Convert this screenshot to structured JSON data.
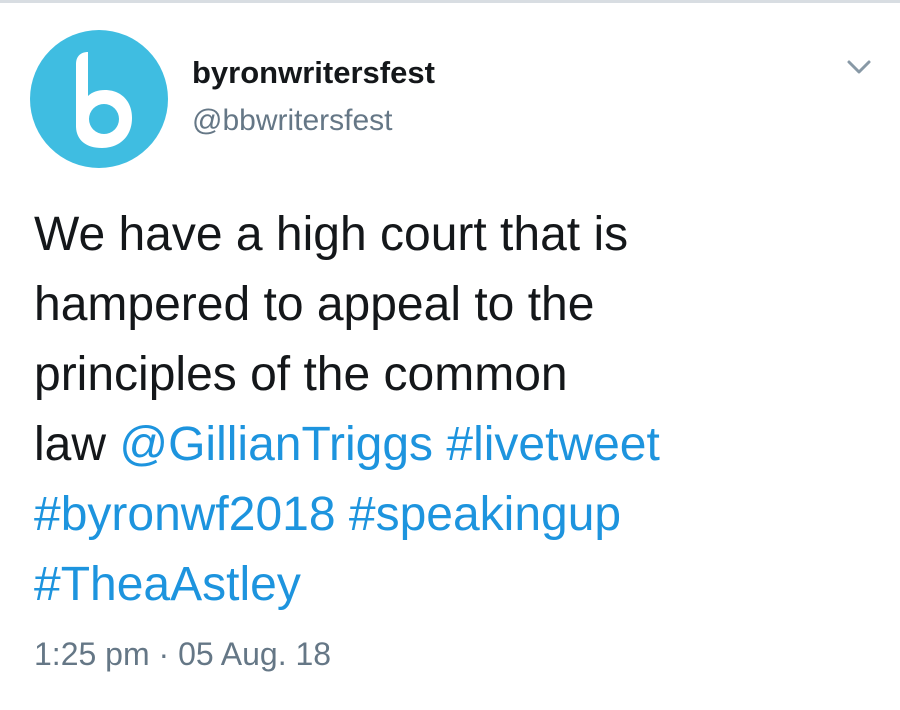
{
  "author": {
    "display_name": "byronwritersfest",
    "handle": "@bbwritersfest",
    "avatar_letter": "b",
    "avatar_color": "#3fbde1"
  },
  "tweet": {
    "text_line_1": "We have a high court that is",
    "text_line_2": "hampered to appeal to the",
    "text_line_3": "principles of the common",
    "text_line_4_prefix": "law ",
    "mention": "@GillianTriggs",
    "hashtag_1": "#livetweet",
    "hashtag_2": "#byronwf2018",
    "hashtag_3": "#speakingup",
    "hashtag_4": "#TheaAstley"
  },
  "meta": {
    "time": "1:25 pm",
    "separator": "·",
    "date": "05 Aug. 18"
  },
  "icons": {
    "menu": "chevron-down-icon"
  },
  "colors": {
    "link": "#1d94de",
    "secondary_text": "#657786",
    "primary_text": "#14171a"
  }
}
